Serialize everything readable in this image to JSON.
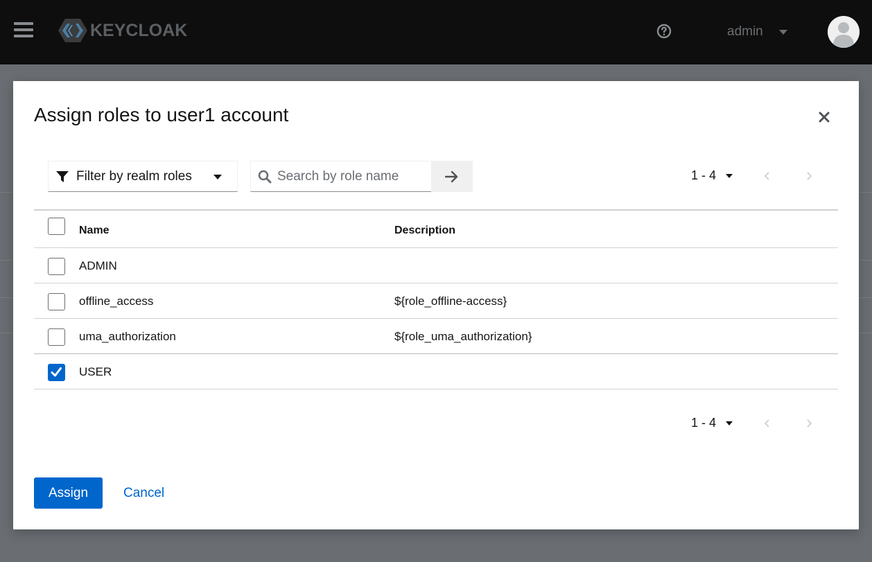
{
  "masthead": {
    "brand": "KEYCLOAK",
    "username": "admin",
    "icons": {
      "menu": "hamburger-icon",
      "help": "help-circle-icon",
      "user": "avatar-icon",
      "dropdown": "caret-down-icon"
    }
  },
  "modal": {
    "title": "Assign roles to user1 account",
    "close_icon": "close-icon",
    "filter": {
      "label": "Filter by realm roles",
      "icon": "filter-icon"
    },
    "search": {
      "placeholder": "Search by role name",
      "value": "",
      "icon": "search-icon",
      "submit_icon": "arrow-right-icon"
    },
    "pagination_top": {
      "range": "1 - 4",
      "prev_icon": "chevron-left-icon",
      "next_icon": "chevron-right-icon"
    },
    "pagination_bottom": {
      "range": "1 - 4",
      "prev_icon": "chevron-left-icon",
      "next_icon": "chevron-right-icon"
    },
    "table": {
      "columns": [
        "Name",
        "Description"
      ],
      "rows": [
        {
          "name": "ADMIN",
          "description": "",
          "checked": false
        },
        {
          "name": "offline_access",
          "description": "${role_offline-access}",
          "checked": false
        },
        {
          "name": "uma_authorization",
          "description": "${role_uma_authorization}",
          "checked": false
        },
        {
          "name": "USER",
          "description": "",
          "checked": true
        }
      ]
    },
    "actions": {
      "assign": "Assign",
      "cancel": "Cancel"
    }
  },
  "colors": {
    "primary": "#0066cc",
    "masthead_bg": "#0e0e0e",
    "backdrop": "#6a6e73"
  }
}
